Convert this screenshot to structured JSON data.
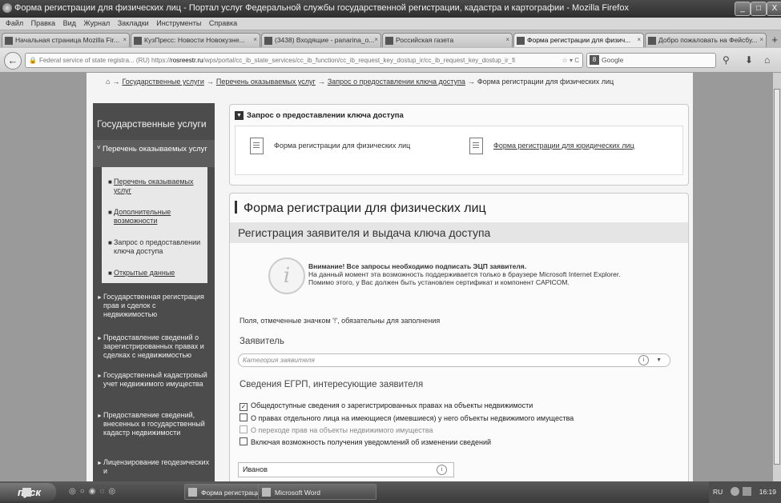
{
  "window": {
    "title": "Форма регистрации для физических лиц - Портал услуг Федеральной службы государственной регистрации, кадастра и картографии - Mozilla Firefox",
    "controls": [
      "_",
      "□",
      "X"
    ]
  },
  "menu": [
    "Файл",
    "Правка",
    "Вид",
    "Журнал",
    "Закладки",
    "Инструменты",
    "Справка"
  ],
  "tabs": [
    {
      "label": "Начальная страница Mozilla Fir...",
      "icon": "firefox-icon",
      "active": false
    },
    {
      "label": "КузПресс: Новости Новокузне...",
      "icon": "news-icon",
      "active": false
    },
    {
      "label": "(3438) Входящие - panarina_o...",
      "icon": "mail-icon",
      "active": false
    },
    {
      "label": "Российская газета",
      "icon": "rg-icon",
      "active": false
    },
    {
      "label": "Форма регистрации для физич...",
      "icon": "rosreestr-icon",
      "active": true
    },
    {
      "label": "Добро пожаловать на Фейсбу...",
      "icon": "facebook-icon",
      "active": false
    }
  ],
  "address": {
    "identity": "Federal service of state registra... (RU)",
    "scheme": "https://",
    "domain": "rosreestr.ru",
    "path": "/wps/portal/cc_ib_state_services/cc_ib_function/cc_ib_request_key_dostup_ir/cc_ib_request_key_dostup_ir_fi"
  },
  "search": {
    "engine": "Google",
    "placeholder": "Google"
  },
  "breadcrumb": {
    "home_icon": "home-icon",
    "items": [
      "Государственные услуги",
      "Перечень оказываемых услуг",
      "Запрос о предоставлении ключа доступа"
    ],
    "current": "Форма регистрации для физических лиц"
  },
  "sidebar": {
    "title": "Государственные услуги",
    "open_section": "Перечень оказываемых услуг",
    "sub_items": [
      {
        "label": "Перечень оказываемых услуг",
        "link": true
      },
      {
        "label": "Дополнительные возможности",
        "link": true
      },
      {
        "label": "Запрос о предоставлении ключа доступа",
        "link": false
      },
      {
        "label": "Открытые данные",
        "link": true
      }
    ],
    "items": [
      "Государственная регистрация прав и сделок с недвижимостью",
      "Предоставление сведений о зарегистрированных правах и сделках с недвижимостью",
      "Государственный кадастровый учет недвижимого имущества",
      "Предоставление сведений, внесенных в государственный кадастр недвижимости",
      "Лицензирование геодезических и"
    ]
  },
  "request_panel": {
    "heading": "Запрос о предоставлении ключа доступа",
    "link_individual": "Форма регистрации для физических лиц",
    "link_legal": "Форма регистрации для юридических лиц"
  },
  "form": {
    "title": "Форма регистрации для физических лиц",
    "subtitle": "Регистрация заявителя и выдача ключа доступа",
    "notice_bold": "Внимание! Все запросы необходимо подписать ЭЦП заявителя.",
    "notice_line2": "На данный момент эта возможность поддерживается только в браузере Microsoft Internet Explorer.",
    "notice_line3": "Помимо этого, у Вас должен быть установлен сертификат и компонент CAPICOM.",
    "required_note": "Поля, отмеченные значком '!', обязательны для заполнения",
    "applicant_label": "Заявитель",
    "applicant_placeholder": "Категория заявителя",
    "egrp_label": "Сведения ЕГРП, интересующие заявителя",
    "checkboxes": [
      {
        "label": "Общедоступные сведения о зарегистрированных правах на объекты недвижимости",
        "checked": true,
        "disabled": false
      },
      {
        "label": "О правах отдельного лица на имеющиеся (имевшиеся) у него объекты недвижимого имущества",
        "checked": false,
        "disabled": false
      },
      {
        "label": "О переходе прав на объекты недвижимого имущества",
        "checked": false,
        "disabled": true
      },
      {
        "label": "Включая возможность получения уведомлений об изменении сведений",
        "checked": false,
        "disabled": false
      }
    ],
    "surname_value": "Иванов"
  },
  "taskbar": {
    "start": "пуск",
    "tasks": [
      "Форма регистрации ...",
      "Microsoft Word"
    ],
    "lang": "RU",
    "clock": "16:19"
  }
}
